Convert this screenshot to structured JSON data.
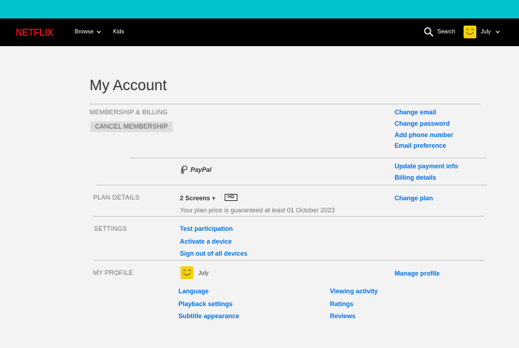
{
  "nav": {
    "logo": "NETFLIX",
    "browse": "Browse",
    "kids": "Kids",
    "search": "Search",
    "user": "July"
  },
  "page": {
    "title": "My Account"
  },
  "membership": {
    "label": "MEMBERSHIP & BILLING",
    "cancel_button": "CANCEL MEMBERSHIP",
    "change_email": "Change email",
    "change_password": "Change password",
    "add_phone": "Add phone number",
    "email_preference": "Email preference",
    "payment_method": "PayPal",
    "update_payment": "Update payment info",
    "billing_details": "Billing details"
  },
  "plan": {
    "label": "PLAN DETAILS",
    "screens": "2 Screens +",
    "quality": "HD",
    "guarantee": "Your plan price is guaranteed at least 01 October 2023",
    "change_plan": "Change plan"
  },
  "settings": {
    "label": "SETTINGS",
    "test_participation": "Test participation",
    "activate_device": "Activate a device",
    "sign_out_all": "Sign out of all devices"
  },
  "profile": {
    "label": "MY PROFILE",
    "name": "July",
    "manage": "Manage profile",
    "language": "Language",
    "playback": "Playback settings",
    "subtitle": "Subtitle appearance",
    "viewing_activity": "Viewing activity",
    "ratings": "Ratings",
    "reviews": "Reviews"
  },
  "colors": {
    "topbar": "#00c3cf",
    "brand": "#e50914",
    "link": "#0071eb",
    "avatar": "#f5d000"
  }
}
